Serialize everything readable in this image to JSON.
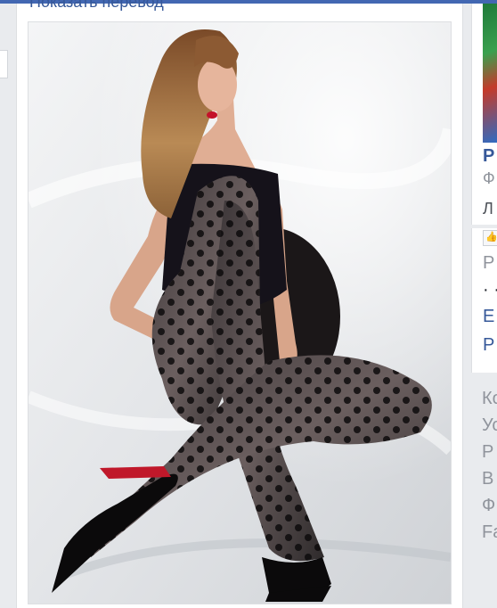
{
  "post": {
    "see_translation": "Показать перевод",
    "photo_description_icon": "photo"
  },
  "right_column": {
    "ad": {
      "title": "P",
      "subtitle": "Ф",
      "like_line": "Л"
    },
    "page_card": {
      "like_icon": "thumbs-up-icon",
      "line1": "P",
      "line2": "· ·",
      "line3": "E",
      "line4": "P"
    },
    "footer_links": [
      "Ко",
      "Ус",
      "Р",
      "В",
      "Ф",
      "Fa"
    ]
  },
  "colors": {
    "brand_blue": "#4267b2",
    "link_blue": "#365899",
    "background": "#e9ebee"
  }
}
